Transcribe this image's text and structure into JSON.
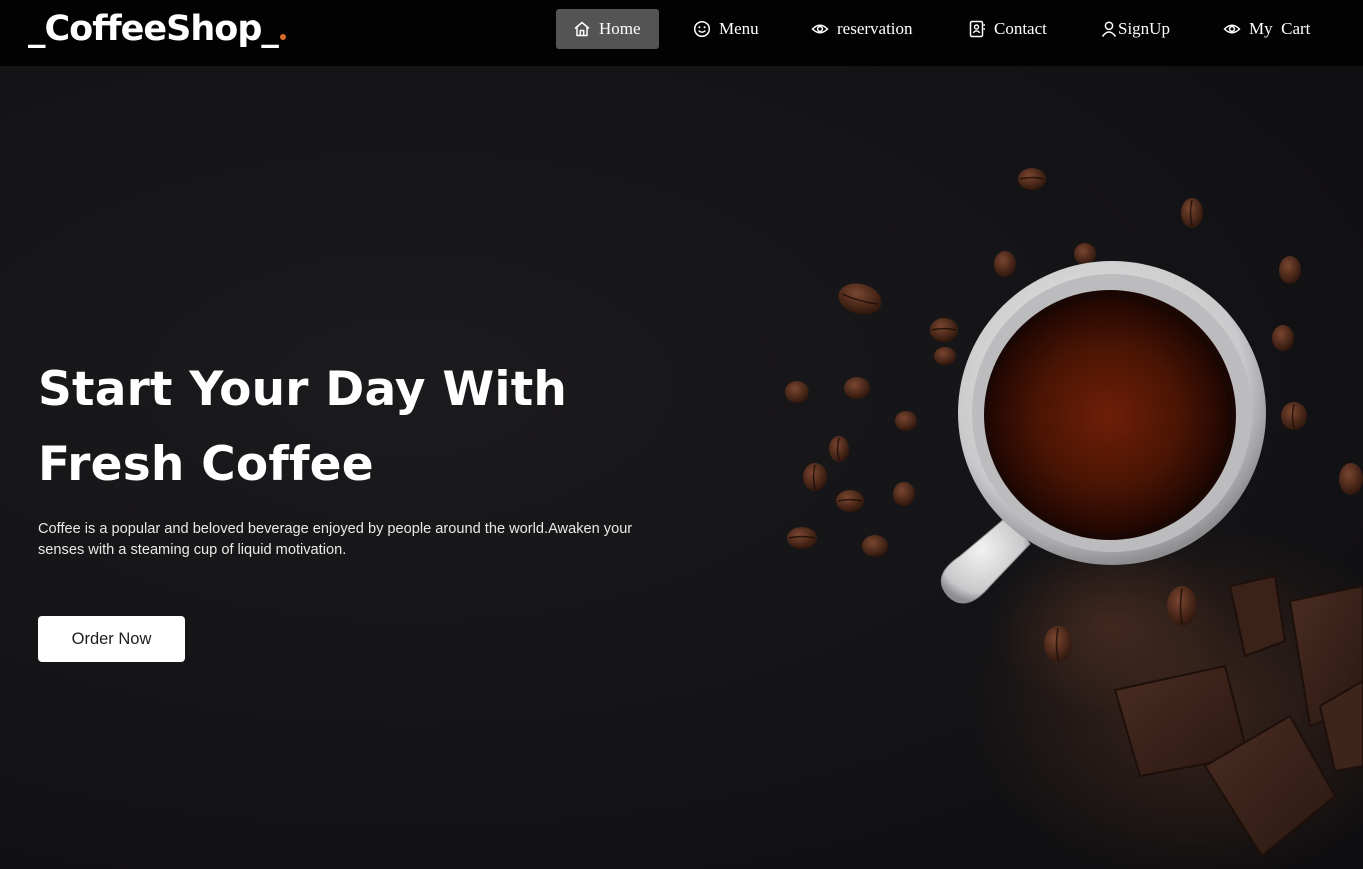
{
  "brand": {
    "logo_text": "_CoffeeShop_",
    "dot_color": "#d86a2c"
  },
  "nav": {
    "items": [
      {
        "label": "Home",
        "icon": "home-icon",
        "active": true
      },
      {
        "label": "Menu",
        "icon": "smile-icon",
        "active": false
      },
      {
        "label": "reservation",
        "icon": "eye-icon",
        "active": false
      },
      {
        "label": "Contact",
        "icon": "contact-book-icon",
        "active": false
      },
      {
        "label": "SignUp",
        "icon": "user-icon",
        "active": false
      },
      {
        "label": "My  Cart",
        "icon": "eye-icon",
        "active": false
      }
    ]
  },
  "hero": {
    "title": "Start Your Day With Fresh Coffee",
    "description": "Coffee is a popular and beloved beverage enjoyed by people around the world.Awaken your senses with a steaming cup of liquid motivation.",
    "button_label": "Order Now",
    "image": "coffee-cup-with-beans-and-chocolate"
  },
  "colors": {
    "navbar_bg": "#020202",
    "active_nav_bg": "#545454",
    "hero_bg": "#141315",
    "button_bg": "#ffffff"
  }
}
